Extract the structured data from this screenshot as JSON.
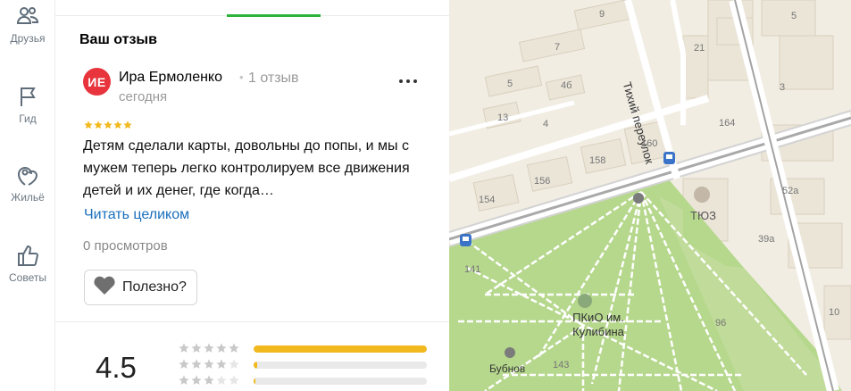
{
  "sidebar": {
    "items": [
      {
        "label": "Друзья",
        "icon": "friends-icon"
      },
      {
        "label": "Гид",
        "icon": "flag-icon"
      },
      {
        "label": "Жильё",
        "icon": "housing-icon"
      },
      {
        "label": "Советы",
        "icon": "thumbs-up-icon"
      }
    ]
  },
  "panel": {
    "section_title": "Ваш отзыв",
    "review": {
      "avatar_initials": "ИЕ",
      "author": "Ира Ермоленко",
      "separator": "•",
      "review_count": "1 отзыв",
      "date": "сегодня",
      "rating": 5,
      "text": "Детям сделали карты, довольны до попы, и мы с мужем теперь легко контролируем все движения детей и их денег, где когда…",
      "read_more": "Читать целиком",
      "views": "0 просмотров",
      "useful_label": "Полезно?"
    },
    "summary": {
      "average": "4.5",
      "distribution": [
        {
          "stars": 5,
          "fraction": 1.0
        },
        {
          "stars": 4,
          "fraction": 0.02
        },
        {
          "stars": 3,
          "fraction": 0.01
        }
      ]
    }
  },
  "colors": {
    "accent_green": "#2db33a",
    "avatar_red": "#e8343c",
    "star_yellow": "#f1b91e",
    "link_blue": "#1a6fbd",
    "park_green": "#b6d88d"
  },
  "map": {
    "street_label": "Тихий переулок",
    "places": [
      {
        "label": "ТЮЗ"
      },
      {
        "label": "ПКиО им. Кулибина"
      },
      {
        "label": "Бубнов"
      }
    ],
    "house_numbers": [
      "9",
      "7",
      "5",
      "4б",
      "13",
      "4",
      "160",
      "158",
      "156",
      "154",
      "164",
      "21",
      "3",
      "52а",
      "39а",
      "10",
      "141",
      "96",
      "143",
      "5"
    ]
  }
}
